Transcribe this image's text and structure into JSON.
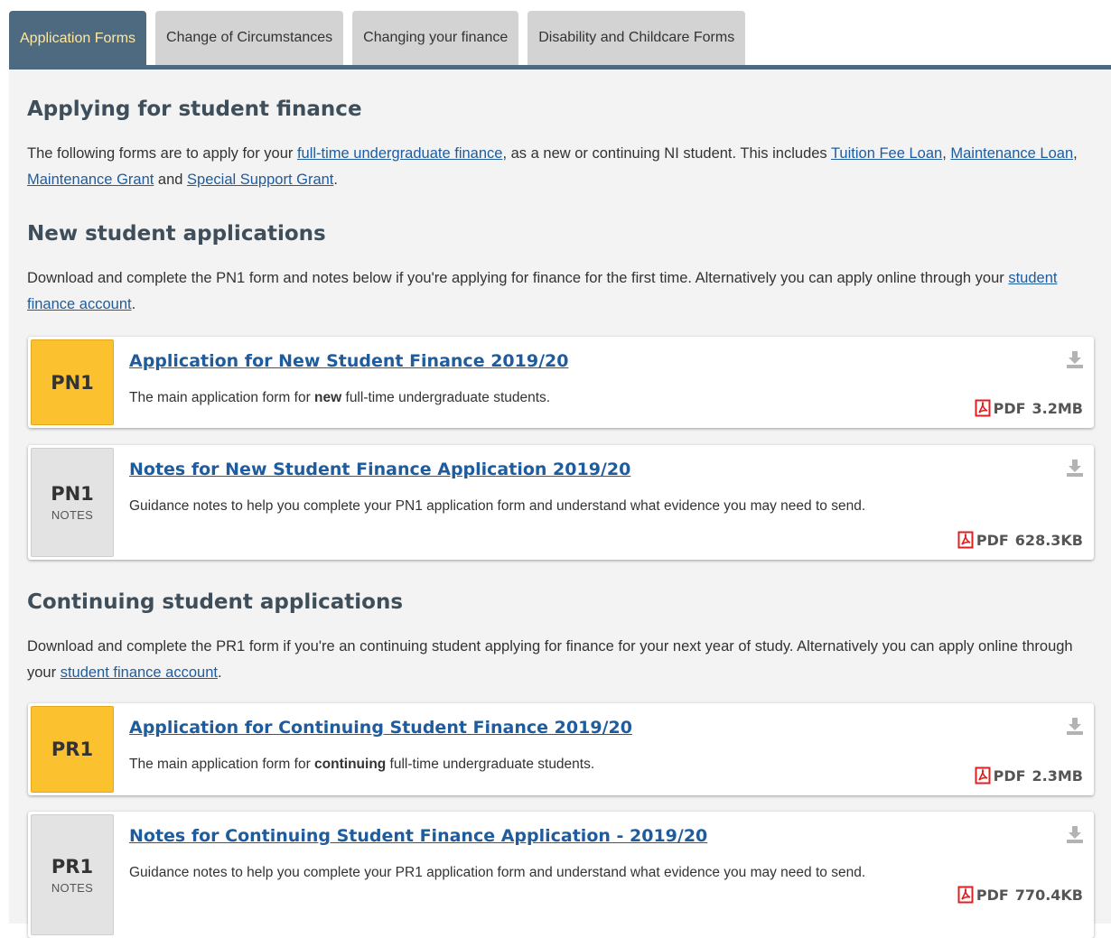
{
  "tabs": [
    {
      "label": "Application Forms",
      "active": true
    },
    {
      "label": "Change of Circumstances",
      "active": false
    },
    {
      "label": "Changing your finance",
      "active": false
    },
    {
      "label": "Disability and Childcare Forms",
      "active": false
    }
  ],
  "section_applying": {
    "heading": "Applying for student finance",
    "text_1": "The following forms are to apply for your ",
    "link_fulltime": "full-time undergraduate finance",
    "text_2": ", as a new or continuing NI student. This includes ",
    "link_tuition": "Tuition Fee Loan",
    "text_3": ", ",
    "link_maintenance_loan": "Maintenance Loan",
    "text_4": ", ",
    "link_maintenance_grant": "Maintenance Grant",
    "text_5": " and ",
    "link_special_support": "Special Support Grant",
    "text_6": "."
  },
  "section_new": {
    "heading": "New student applications",
    "text_1": "Download and complete the PN1 form and notes below if you're applying for finance for the first time. Alternatively you can apply online through your ",
    "link": "student finance account",
    "text_2": "."
  },
  "section_continuing": {
    "heading": "Continuing student applications",
    "text_1": "Download and complete the PR1 form if you're an continuing student applying for finance for your next year of study. Alternatively you can apply online through your ",
    "link": "student finance account",
    "text_2": "."
  },
  "cards": [
    {
      "code": "PN1",
      "sub": "",
      "title": "Application for New Student Finance 2019/20",
      "desc_1": "The main application form for ",
      "desc_bold": "new",
      "desc_2": " full-time undergraduate students.",
      "file_type": "PDF",
      "size": "3.2MB"
    },
    {
      "code": "PN1",
      "sub": "NOTES",
      "title": "Notes for New Student Finance Application 2019/20",
      "desc_1": "Guidance notes to help you complete your PN1 application form and understand what evidence you may need to send.",
      "desc_bold": "",
      "desc_2": "",
      "file_type": "PDF",
      "size": "628.3KB"
    },
    {
      "code": "PR1",
      "sub": "",
      "title": "Application for Continuing Student Finance 2019/20",
      "desc_1": "The main application form for ",
      "desc_bold": "continuing",
      "desc_2": " full-time undergraduate students.",
      "file_type": "PDF",
      "size": "2.3MB"
    },
    {
      "code": "PR1",
      "sub": "NOTES",
      "title": "Notes for Continuing Student Finance Application - 2019/20",
      "desc_1": "Guidance notes to help you complete your PR1 application form and understand what evidence you may need to send.",
      "desc_bold": "",
      "desc_2": "",
      "file_type": "PDF",
      "size": "770.4KB"
    }
  ],
  "colors": {
    "tab_active_bg": "#4d6a80",
    "tab_active_text": "#ffe8a0",
    "badge_yellow": "#fcc12e",
    "badge_grey": "#e3e3e3",
    "link": "#1e5c9e",
    "pdf_red": "#e02020"
  }
}
